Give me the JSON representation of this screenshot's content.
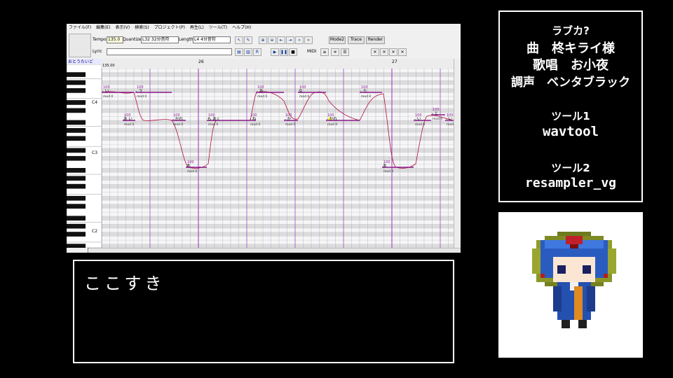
{
  "menu": [
    "ファイル(F)",
    "編集(E)",
    "表示(V)",
    "検索(S)",
    "プロジェクト(P)",
    "再生(L)",
    "ツール(T)",
    "ヘルプ(H)"
  ],
  "toolbar": {
    "tempo_label": "Tempo",
    "tempo_value": "135.0",
    "quantize_label": "Quantize",
    "quantize_value": "L32 32分音符",
    "length_label": "Length",
    "length_value": "L4  4分音符",
    "mode2": "Mode2",
    "trace": "Trace",
    "render": "Render",
    "lyric_label": "Lyric",
    "midi_label": "MIDI"
  },
  "editor": {
    "voicebank": "おとうたいど",
    "tempo_marker": "135.00",
    "measure_labels": [
      "26",
      "27"
    ],
    "octave_labels": [
      "C4",
      "C3",
      "C2"
    ],
    "notes": [
      {
        "lyric": "- い",
        "vel": "100"
      },
      {
        "lyric": "- う",
        "vel": "100"
      },
      {
        "lyric": "あ い",
        "vel": "100"
      },
      {
        "lyric": "- かれ",
        "vel": "100"
      },
      {
        "lyric": "あ",
        "vel": "100"
      },
      {
        "lyric": "も あく",
        "vel": "100"
      },
      {
        "lyric": "- ね",
        "vel": "100"
      },
      {
        "lyric": "- あ",
        "vel": "100"
      },
      {
        "lyric": "- か",
        "vel": "100"
      },
      {
        "lyric": "な",
        "vel": "100"
      },
      {
        "lyric": "- かれ",
        "vel": "100"
      },
      {
        "lyric": "- ら",
        "vel": "100"
      },
      {
        "lyric": "あ",
        "vel": "100"
      },
      {
        "lyric": "- い",
        "vel": "100"
      },
      {
        "lyric": "- と",
        "vel": "100"
      },
      {
        "lyric": "- い",
        "vel": "100"
      }
    ],
    "note_sub": "mod 0",
    "extra_vel": [
      "100",
      "40"
    ]
  },
  "scroll_button": "P",
  "textbox": {
    "text": "ここすき"
  },
  "credits": {
    "title": "ラブカ?",
    "song": "曲　柊キライ様",
    "singer": "歌唱　お小夜",
    "tuning": "調声　ベンタブラック",
    "tool1_label": "ツール1",
    "tool1_value": "wavtool",
    "tool2_label": "ツール2",
    "tool2_value": "resampler_vg"
  },
  "colors": {
    "background": "#000000",
    "note_line": "#8a1a8a",
    "pitch_curve": "#b0103c",
    "beat_line": "#a040c8",
    "grid": "#7878c8"
  }
}
